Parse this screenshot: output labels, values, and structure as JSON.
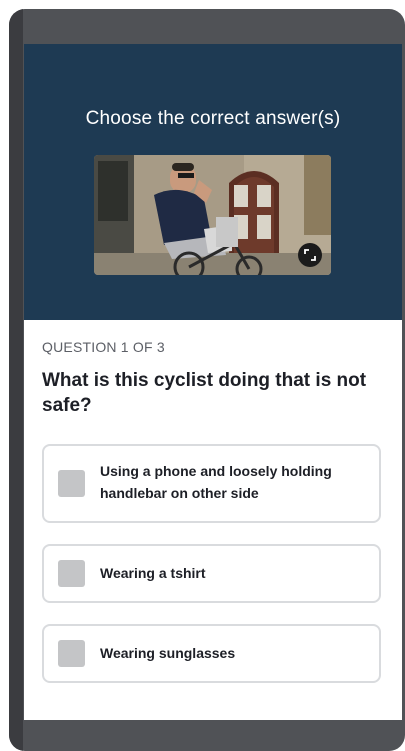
{
  "header": {
    "title": "Choose the correct answer(s)",
    "photo_alt": "cyclist-photo",
    "expand_icon": "expand-icon"
  },
  "question": {
    "counter": "QUESTION 1 OF 3",
    "text": "What is this cyclist doing that is not safe?"
  },
  "options": [
    {
      "label": "Using a phone and loosely holding handlebar on other side",
      "checked": false
    },
    {
      "label": "Wearing a tshirt",
      "checked": false
    },
    {
      "label": "Wearing sunglasses",
      "checked": false
    }
  ],
  "colors": {
    "header_bg": "#1e3a53",
    "frame": "#505256",
    "checkbox": "#c4c5c7",
    "option_border": "#d9dbde"
  }
}
